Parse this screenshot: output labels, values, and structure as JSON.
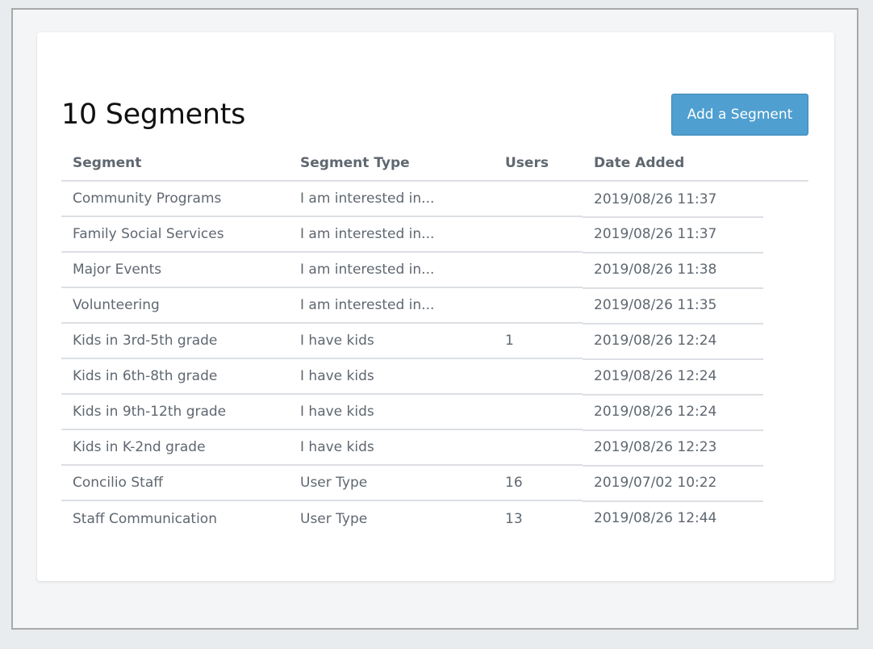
{
  "header": {
    "title": "10 Segments",
    "add_button_label": "Add a Segment"
  },
  "table": {
    "columns": [
      "Segment",
      "Segment Type",
      "Users",
      "Date Added"
    ],
    "rows": [
      {
        "segment": "Community Programs",
        "type": "I am interested in...",
        "users": "",
        "date": "2019/08/26 11:37"
      },
      {
        "segment": "Family Social Services",
        "type": "I am interested in...",
        "users": "",
        "date": "2019/08/26 11:37"
      },
      {
        "segment": "Major Events",
        "type": "I am interested in...",
        "users": "",
        "date": "2019/08/26 11:38"
      },
      {
        "segment": "Volunteering",
        "type": "I am interested in...",
        "users": "",
        "date": "2019/08/26 11:35"
      },
      {
        "segment": "Kids in 3rd-5th grade",
        "type": "I have kids",
        "users": "1",
        "date": "2019/08/26 12:24"
      },
      {
        "segment": "Kids in 6th-8th grade",
        "type": "I have kids",
        "users": "",
        "date": "2019/08/26 12:24"
      },
      {
        "segment": "Kids in 9th-12th grade",
        "type": "I have kids",
        "users": "",
        "date": "2019/08/26 12:24"
      },
      {
        "segment": "Kids in K-2nd grade",
        "type": "I have kids",
        "users": "",
        "date": "2019/08/26 12:23"
      },
      {
        "segment": "Concilio Staff",
        "type": "User Type",
        "users": "16",
        "date": "2019/07/02 10:22"
      },
      {
        "segment": "Staff Communication",
        "type": "User Type",
        "users": "13",
        "date": "2019/08/26 12:44"
      }
    ]
  },
  "colors": {
    "accent": "#4f9fd0",
    "text_muted": "#5f6770",
    "divider": "#dcdfe3"
  }
}
